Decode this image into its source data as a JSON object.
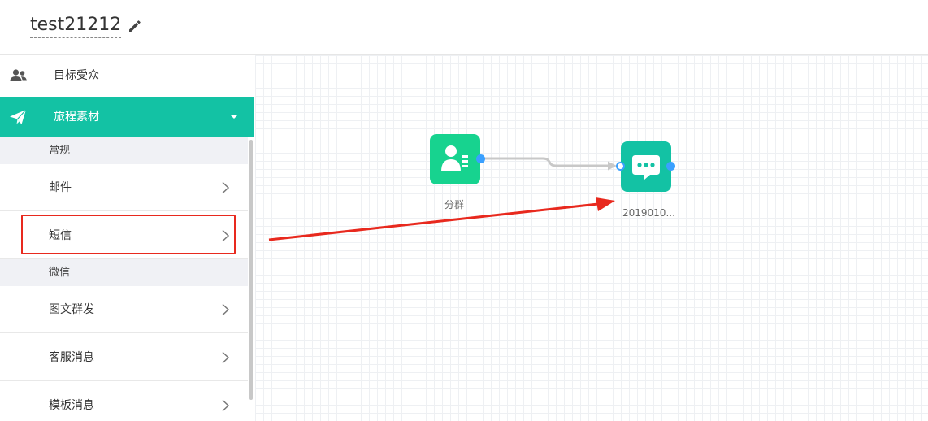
{
  "header": {
    "title": "test21212",
    "edit_icon": "pencil-icon"
  },
  "sidebar": {
    "top_item": {
      "label": "目标受众",
      "icon": "users-icon"
    },
    "active_section": {
      "label": "旅程素材",
      "icon": "paper-plane-icon",
      "expanded": true
    },
    "groups": [
      {
        "label": "常规",
        "items": [
          {
            "label": "邮件"
          },
          {
            "label": "短信",
            "highlighted": true
          }
        ]
      },
      {
        "label": "微信",
        "items": [
          {
            "label": "图文群发"
          },
          {
            "label": "客服消息"
          },
          {
            "label": "模板消息"
          }
        ]
      }
    ]
  },
  "canvas": {
    "nodes": [
      {
        "label": "分群",
        "icon": "user-list-icon",
        "color": "#17d38f"
      },
      {
        "label": "2019010...",
        "icon": "chat-bubble-icon",
        "color": "#13c2a4"
      }
    ]
  },
  "colors": {
    "accent": "#13c2a4",
    "highlight": "#e8291e",
    "port": "#3aa0ff"
  }
}
